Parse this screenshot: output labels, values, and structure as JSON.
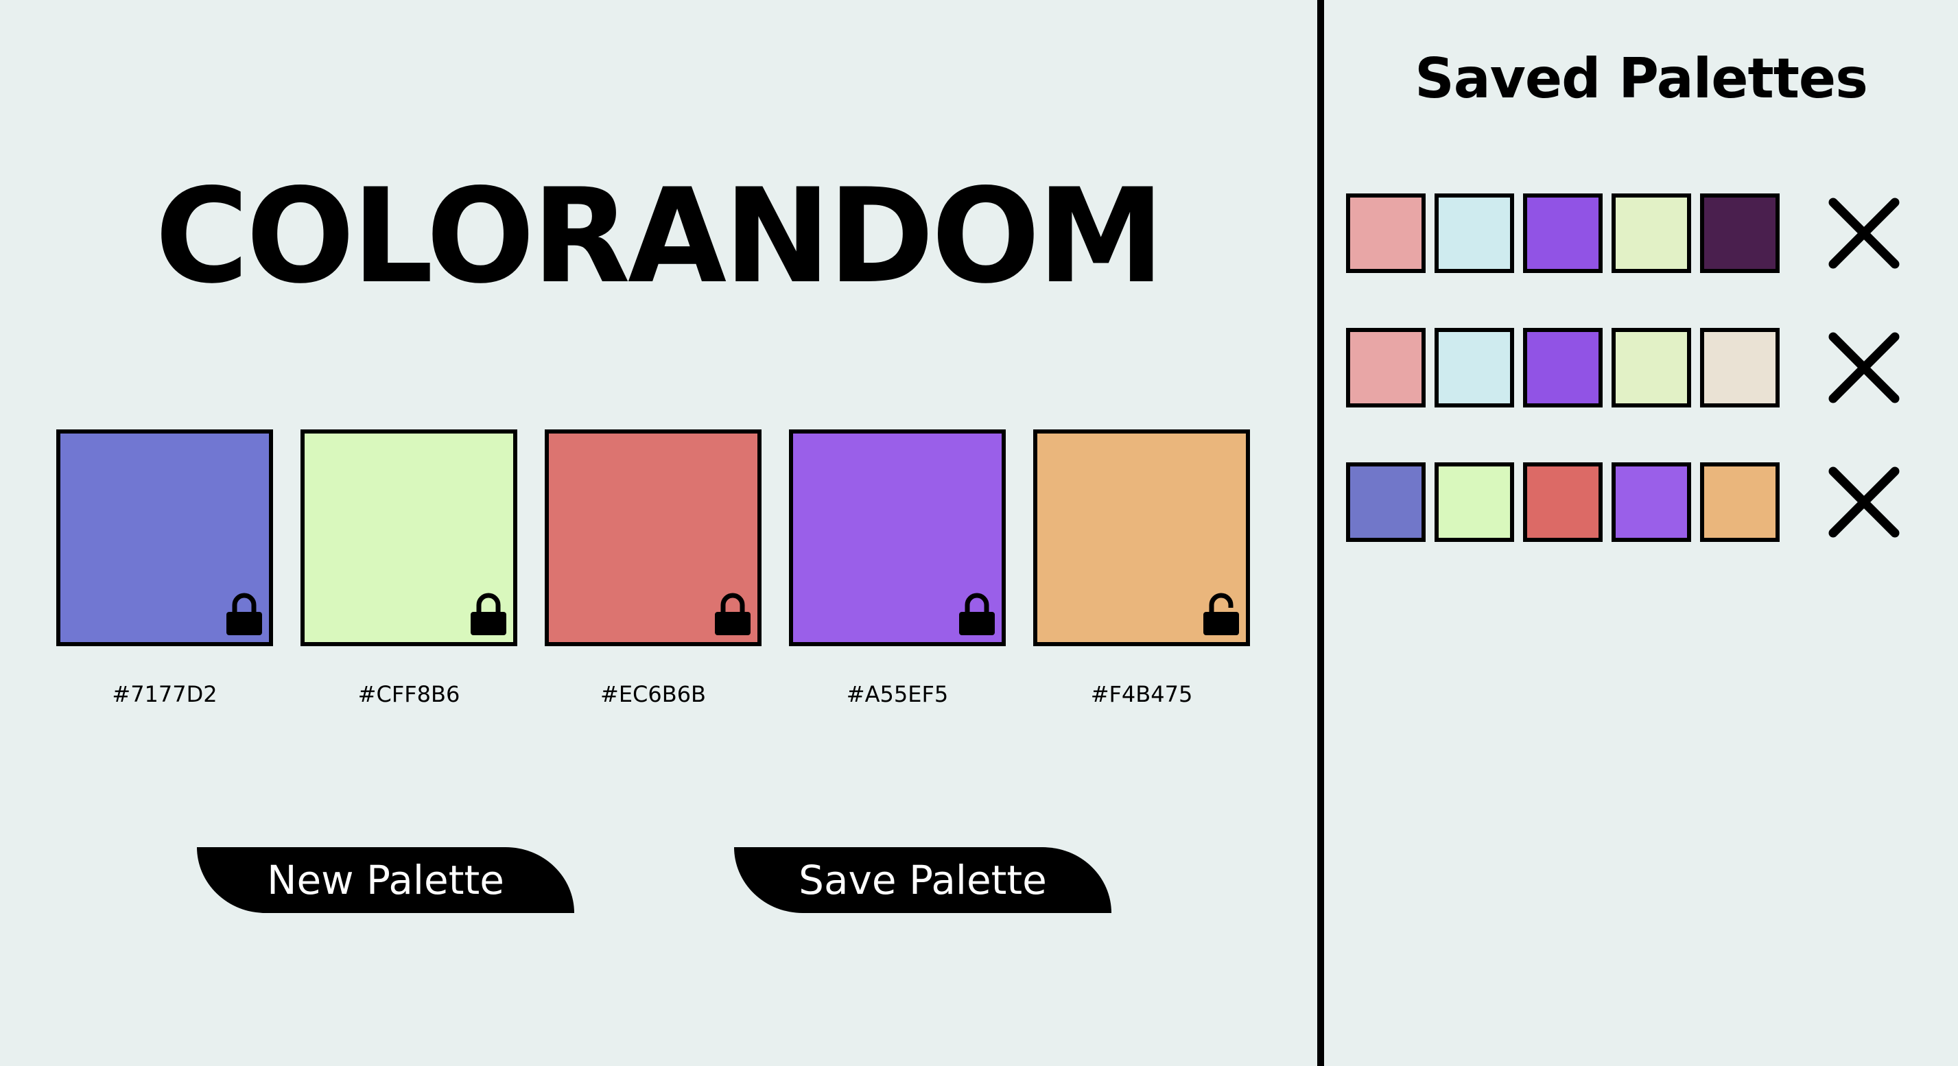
{
  "app": {
    "title": "COLORANDOM"
  },
  "palette": {
    "swatches": [
      {
        "hex": "#7177D2",
        "color": "#7177D2",
        "locked": true
      },
      {
        "hex": "#CFF8B6",
        "color": "#D9F8BD",
        "locked": true
      },
      {
        "hex": "#EC6B6B",
        "color": "#DC7470",
        "locked": true
      },
      {
        "hex": "#A55EF5",
        "color": "#9A5FE9",
        "locked": true
      },
      {
        "hex": "#F4B475",
        "color": "#EAB67C",
        "locked": false
      }
    ]
  },
  "buttons": {
    "new_label": "New Palette",
    "save_label": "Save Palette"
  },
  "sidebar": {
    "title": "Saved Palettes",
    "saved": [
      {
        "colors": [
          "#E8A6A6",
          "#CFEBEF",
          "#9153E5",
          "#E2F1C6",
          "#4A1F4E"
        ]
      },
      {
        "colors": [
          "#E8A6A6",
          "#CFEBEF",
          "#9153E5",
          "#E2F1C6",
          "#EAE2D4"
        ]
      },
      {
        "colors": [
          "#7177C9",
          "#D9F8BD",
          "#DC6A66",
          "#9A5FE9",
          "#EAB67C"
        ]
      }
    ]
  },
  "icons": {
    "lock_closed": "lock-icon",
    "lock_open": "unlock-icon",
    "delete": "close-icon"
  }
}
